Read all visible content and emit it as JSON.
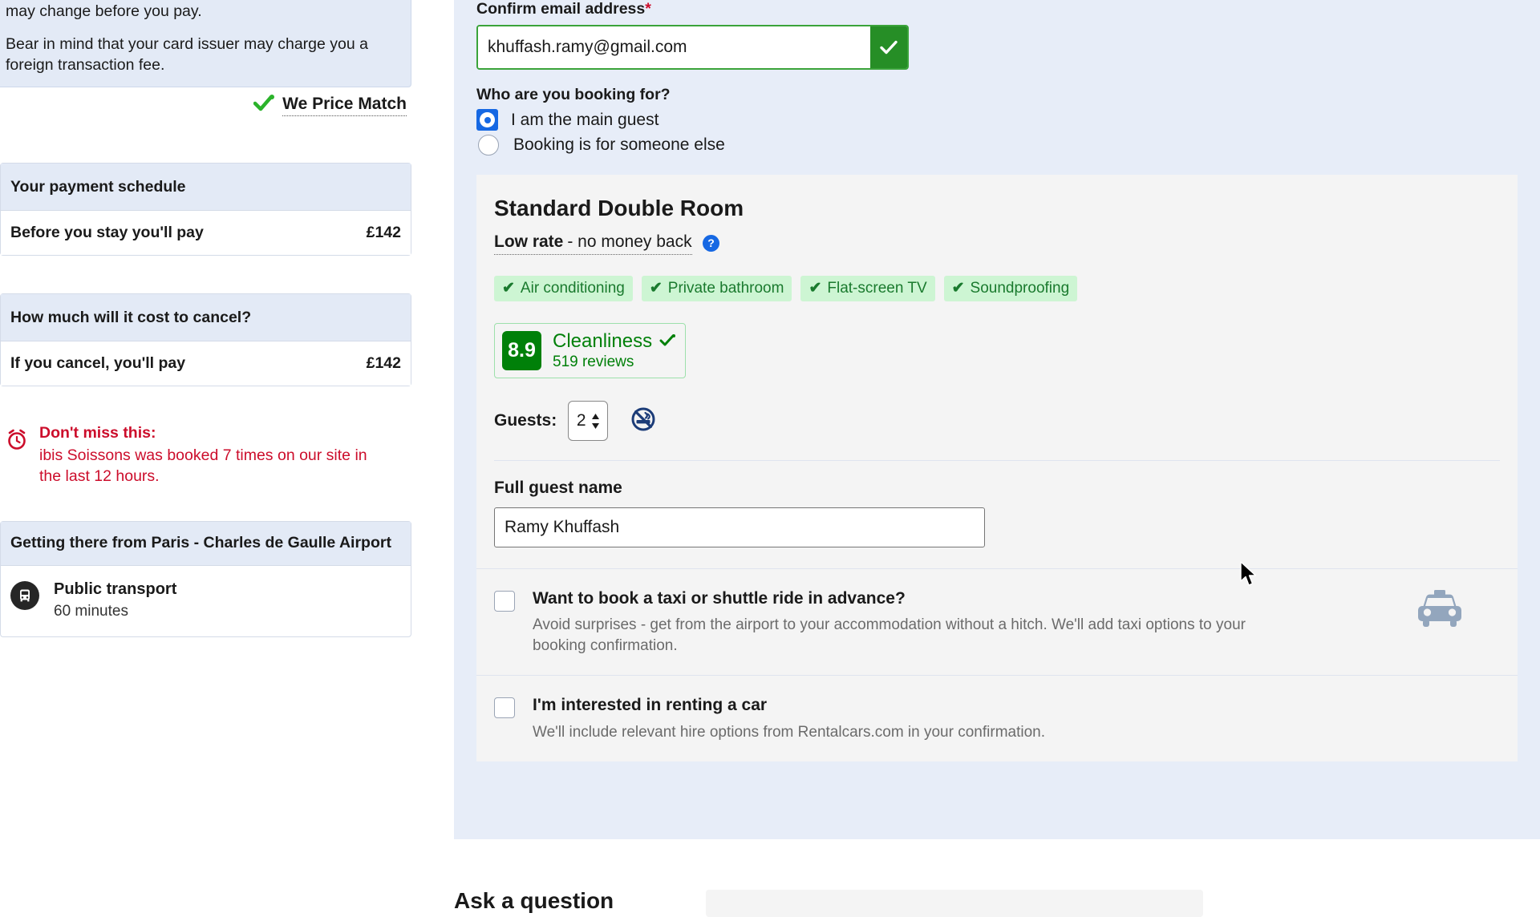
{
  "left": {
    "fx_note": {
      "line1": "approximate cost in £. You'll pay in €. The exchange rate may change before you pay.",
      "line2": "Bear in mind that your card issuer may charge you a foreign transaction fee."
    },
    "price_match": {
      "label": "We Price Match",
      "icon": "green-check-icon"
    },
    "payment_schedule": {
      "heading": "Your payment schedule",
      "row_label": "Before you stay you'll pay",
      "row_amount": "£142"
    },
    "cancellation": {
      "heading": "How much will it cost to cancel?",
      "row_label": "If you cancel, you'll pay",
      "row_amount": "£142"
    },
    "dont_miss": {
      "icon": "alarm-clock-icon",
      "title": "Don't miss this:",
      "body": "ibis Soissons was booked 7 times on our site in the last 12 hours.",
      "color": "#cc0d2b"
    },
    "getting_there": {
      "heading": "Getting there from Paris - Charles de Gaulle Airport",
      "mode_icon": "bus-icon",
      "mode": "Public transport",
      "duration": "60 minutes"
    }
  },
  "right": {
    "email": {
      "label": "Confirm email address",
      "required_mark": "*",
      "value": "khuffash.ramy@gmail.com",
      "placeholder": "Confirm email address",
      "valid_icon": "check-icon",
      "valid_color": "#268e26"
    },
    "who_booking": {
      "title": "Who are you booking for?",
      "options": [
        {
          "label": "I am the main guest",
          "selected": true
        },
        {
          "label": "Booking is for someone else",
          "selected": false
        }
      ]
    },
    "room": {
      "title": "Standard Double Room",
      "rate_strong": "Low rate",
      "rate_rest": "- no money back",
      "help_icon": "question-mark-icon",
      "facilities": [
        "Air conditioning",
        "Private bathroom",
        "Flat-screen TV",
        "Soundproofing"
      ],
      "cleanliness": {
        "score": "8.9",
        "label": "Cleanliness",
        "reviews": "519 reviews",
        "verified_icon": "green-check-icon",
        "color": "#008009"
      },
      "guests": {
        "label": "Guests:",
        "value": "2",
        "stepper_icon": "up-down-arrows-icon",
        "non_smoking_icon": "no-smoking-icon"
      },
      "guest_name": {
        "label": "Full guest name",
        "value": "Ramy Khuffash",
        "placeholder": "Full guest name"
      }
    },
    "addons": [
      {
        "checked": false,
        "title": "Want to book a taxi or shuttle ride in advance?",
        "desc": "Avoid surprises - get from the airport to your accommodation without a hitch. We'll add taxi options to your booking confirmation.",
        "icon": "taxi-icon"
      },
      {
        "checked": false,
        "title": "I'm interested in renting a car",
        "desc": "We'll include relevant hire options from Rentalcars.com in your confirmation.",
        "icon": ""
      }
    ],
    "ask": {
      "title": "Ask a question"
    }
  }
}
